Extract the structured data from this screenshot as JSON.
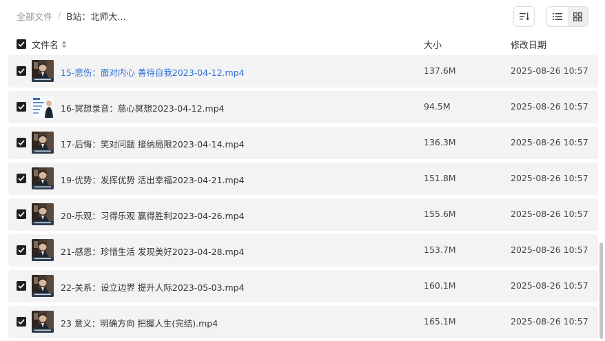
{
  "breadcrumb": {
    "root": "全部文件",
    "separator": "/",
    "current": "B站：北师大..."
  },
  "columns": {
    "name": "文件名",
    "size": "大小",
    "modified": "修改日期"
  },
  "rows": [
    {
      "name": "15-悲伤：面对内心 善待自我2023-04-12.mp4",
      "size": "137.6M",
      "date": "2025-08-26 10:57",
      "thumb": "person"
    },
    {
      "name": "16-冥想录音：慈心冥想2023-04-12.mp4",
      "size": "94.5M",
      "date": "2025-08-26 10:57",
      "thumb": "slide"
    },
    {
      "name": "17-后悔：笑对问题 接纳局限2023-04-14.mp4",
      "size": "136.3M",
      "date": "2025-08-26 10:57",
      "thumb": "person"
    },
    {
      "name": "19-优势：发挥优势 活出幸福2023-04-21.mp4",
      "size": "151.8M",
      "date": "2025-08-26 10:57",
      "thumb": "person"
    },
    {
      "name": "20-乐观：习得乐观 赢得胜利2023-04-26.mp4",
      "size": "155.6M",
      "date": "2025-08-26 10:57",
      "thumb": "person"
    },
    {
      "name": "21-感恩：珍惜生活 发现美好2023-04-28.mp4",
      "size": "153.7M",
      "date": "2025-08-26 10:57",
      "thumb": "person"
    },
    {
      "name": "22-关系：设立边界 提升人际2023-05-03.mp4",
      "size": "160.1M",
      "date": "2025-08-26 10:57",
      "thumb": "person"
    },
    {
      "name": "23 意义：明确方向 把握人生(完结).mp4",
      "size": "165.1M",
      "date": "2025-08-26 10:57",
      "thumb": "person"
    }
  ],
  "highlight_row": 0,
  "colors": {
    "link": "#2b6fd6",
    "row_bg": "#f3f3f3",
    "checkbox": "#1f1f1f"
  },
  "icons": {
    "sort": "sort-descending-icon",
    "list_view": "list-view-icon",
    "grid_view": "grid-view-icon",
    "checkbox": "checkmark-icon",
    "column_sort": "sort-arrows-icon"
  }
}
